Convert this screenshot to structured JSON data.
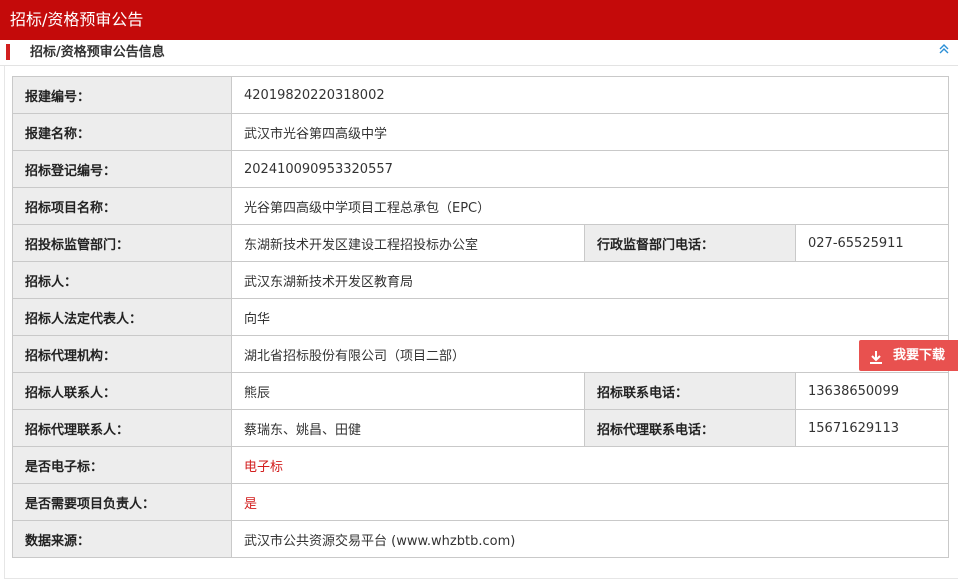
{
  "header": {
    "title": "招标/资格预审公告"
  },
  "section": {
    "title": "招标/资格预审公告信息",
    "collapse_icon": "double-chevron-up-icon"
  },
  "rows": [
    {
      "label": "报建编号：",
      "value": "42019820220318002"
    },
    {
      "label": "报建名称：",
      "value": "武汉市光谷第四高级中学"
    },
    {
      "label": "招标登记编号：",
      "value": "202410090953320557"
    },
    {
      "label": "招标项目名称：",
      "value": "光谷第四高级中学项目工程总承包（EPC）"
    },
    {
      "label": "招投标监管部门：",
      "value": "东湖新技术开发区建设工程招投标办公室",
      "label2": "行政监督部门电话：",
      "value2": "027-65525911"
    },
    {
      "label": "招标人：",
      "value": "武汉东湖新技术开发区教育局"
    },
    {
      "label": "招标人法定代表人：",
      "value": "向华"
    },
    {
      "label": "招标代理机构：",
      "value": "湖北省招标股份有限公司（项目二部）"
    },
    {
      "label": "招标人联系人：",
      "value": "熊辰",
      "label2": "招标联系电话：",
      "value2": "13638650099"
    },
    {
      "label": "招标代理联系人：",
      "value": "蔡瑞东、姚昌、田健",
      "label2": "招标代理联系电话：",
      "value2": "15671629113"
    },
    {
      "label": "是否电子标：",
      "value": "电子标"
    },
    {
      "label": "是否需要项目负责人：",
      "value": "是"
    },
    {
      "label": "数据来源：",
      "value": " 武汉市公共资源交易平台 (www.whzbtb.com)"
    }
  ],
  "download": {
    "label": "我要下载",
    "icon": "download-icon"
  },
  "colors": {
    "brand_red": "#c40a0a",
    "highlight_red": "#d21f1f",
    "download_bg": "#e8514f",
    "accent_blue": "#2b8fd6"
  }
}
